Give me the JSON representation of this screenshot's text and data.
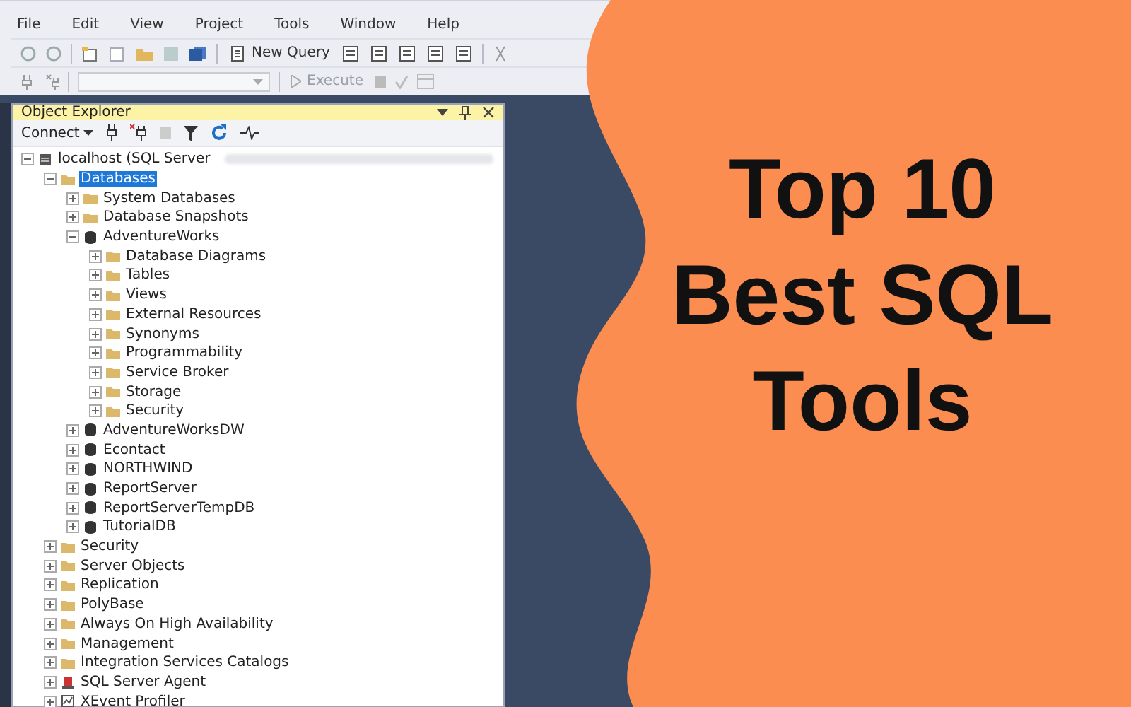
{
  "menu": [
    {
      "label": "File"
    },
    {
      "label": "Edit"
    },
    {
      "label": "View"
    },
    {
      "label": "Project"
    },
    {
      "label": "Tools"
    },
    {
      "label": "Window"
    },
    {
      "label": "Help"
    }
  ],
  "toolbar": {
    "new_query": "New Query",
    "execute": {
      "label": "Execute",
      "disabled": true
    }
  },
  "object_explorer": {
    "title": "Object Explorer",
    "connect": "Connect",
    "tree": [
      {
        "label": "localhost (SQL Server",
        "kind": "server",
        "expanded": true,
        "selected": false,
        "children": [
          {
            "label": "Databases",
            "kind": "folder",
            "expanded": true,
            "selected": true,
            "children": [
              {
                "label": "System Databases",
                "kind": "folder",
                "expanded": false,
                "selected": false
              },
              {
                "label": "Database Snapshots",
                "kind": "folder",
                "expanded": false,
                "selected": false
              },
              {
                "label": "AdventureWorks",
                "kind": "database",
                "expanded": true,
                "selected": false,
                "children": [
                  {
                    "label": "Database Diagrams",
                    "kind": "folder",
                    "expanded": false,
                    "selected": false
                  },
                  {
                    "label": "Tables",
                    "kind": "folder",
                    "expanded": false,
                    "selected": false
                  },
                  {
                    "label": "Views",
                    "kind": "folder",
                    "expanded": false,
                    "selected": false
                  },
                  {
                    "label": "External Resources",
                    "kind": "folder",
                    "expanded": false,
                    "selected": false
                  },
                  {
                    "label": "Synonyms",
                    "kind": "folder",
                    "expanded": false,
                    "selected": false
                  },
                  {
                    "label": "Programmability",
                    "kind": "folder",
                    "expanded": false,
                    "selected": false
                  },
                  {
                    "label": "Service Broker",
                    "kind": "folder",
                    "expanded": false,
                    "selected": false
                  },
                  {
                    "label": "Storage",
                    "kind": "folder",
                    "expanded": false,
                    "selected": false
                  },
                  {
                    "label": "Security",
                    "kind": "folder",
                    "expanded": false,
                    "selected": false
                  }
                ]
              },
              {
                "label": "AdventureWorksDW",
                "kind": "database",
                "expanded": false,
                "selected": false
              },
              {
                "label": "Econtact",
                "kind": "database",
                "expanded": false,
                "selected": false
              },
              {
                "label": "NORTHWIND",
                "kind": "database",
                "expanded": false,
                "selected": false
              },
              {
                "label": "ReportServer",
                "kind": "database",
                "expanded": false,
                "selected": false
              },
              {
                "label": "ReportServerTempDB",
                "kind": "database",
                "expanded": false,
                "selected": false
              },
              {
                "label": "TutorialDB",
                "kind": "database",
                "expanded": false,
                "selected": false
              }
            ]
          },
          {
            "label": "Security",
            "kind": "folder",
            "expanded": false,
            "selected": false
          },
          {
            "label": "Server Objects",
            "kind": "folder",
            "expanded": false,
            "selected": false
          },
          {
            "label": "Replication",
            "kind": "folder",
            "expanded": false,
            "selected": false
          },
          {
            "label": "PolyBase",
            "kind": "folder",
            "expanded": false,
            "selected": false
          },
          {
            "label": "Always On High Availability",
            "kind": "folder",
            "expanded": false,
            "selected": false
          },
          {
            "label": "Management",
            "kind": "folder",
            "expanded": false,
            "selected": false
          },
          {
            "label": "Integration Services Catalogs",
            "kind": "folder",
            "expanded": false,
            "selected": false
          },
          {
            "label": "SQL Server Agent",
            "kind": "agent",
            "expanded": false,
            "selected": false
          },
          {
            "label": "XEvent Profiler",
            "kind": "profiler",
            "expanded": false,
            "selected": false
          }
        ]
      }
    ]
  },
  "headline": "Top 10 Best SQL Tools"
}
